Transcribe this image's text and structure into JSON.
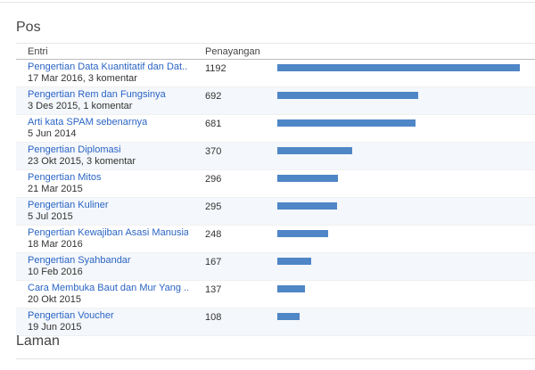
{
  "sections": {
    "posts_title": "Pos",
    "pages_title": "Laman"
  },
  "table": {
    "headers": {
      "entry": "Entri",
      "views": "Penayangan"
    },
    "max_views": 1192,
    "rows": [
      {
        "title": "Pengertian Data Kuantitatif dan Dat...",
        "meta": "17 Mar 2016, 3 komentar",
        "views": 1192
      },
      {
        "title": "Pengertian Rem dan Fungsinya",
        "meta": "3 Des 2015, 1 komentar",
        "views": 692
      },
      {
        "title": "Arti kata SPAM sebenarnya",
        "meta": "5 Jun 2014",
        "views": 681
      },
      {
        "title": "Pengertian Diplomasi",
        "meta": "23 Okt 2015, 3 komentar",
        "views": 370
      },
      {
        "title": "Pengertian Mitos",
        "meta": "21 Mar 2015",
        "views": 296
      },
      {
        "title": "Pengertian Kuliner",
        "meta": "5 Jul 2015",
        "views": 295
      },
      {
        "title": "Pengertian Kewajiban Asasi Manusia",
        "meta": "18 Mar 2016",
        "views": 248
      },
      {
        "title": "Pengertian Syahbandar",
        "meta": "10 Feb 2016",
        "views": 167
      },
      {
        "title": "Cara Membuka Baut dan Mur Yang ...",
        "meta": "20 Okt 2015",
        "views": 137
      },
      {
        "title": "Pengertian Voucher",
        "meta": "19 Jun 2015",
        "views": 108
      }
    ]
  },
  "colors": {
    "bar": "#4f86c6",
    "link": "#2a64c5",
    "row_shade": "#f4f7fb"
  }
}
